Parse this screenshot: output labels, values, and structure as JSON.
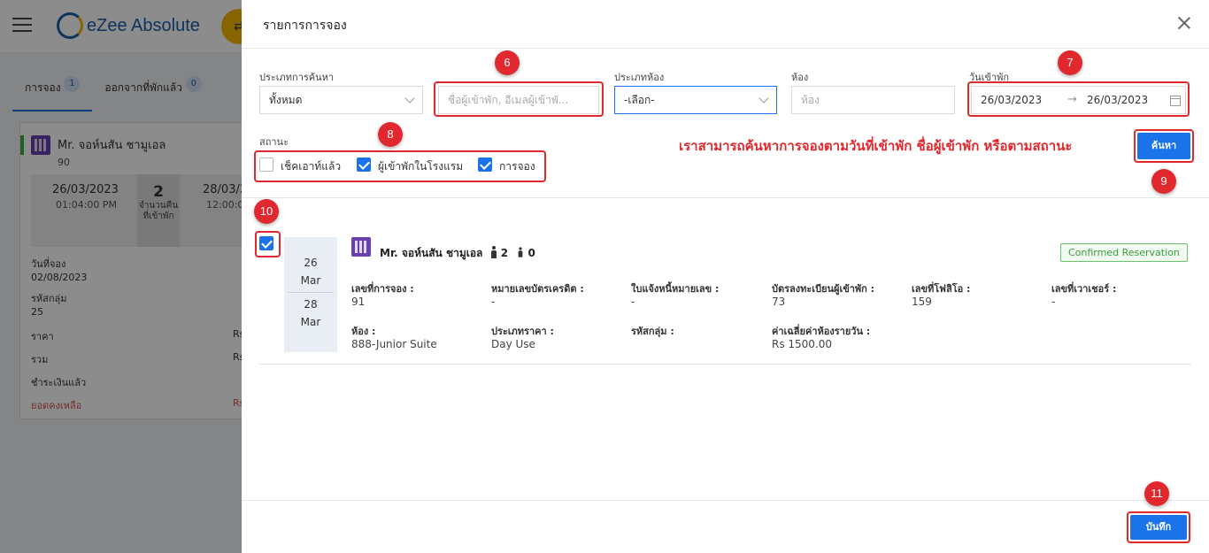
{
  "app": {
    "brand": "eZee Absolute",
    "yellow_icon": "⇄",
    "tabs": [
      {
        "label": "การจอง",
        "badge": "1"
      },
      {
        "label": "ออกจากที่พักแล้ว",
        "badge": "0"
      }
    ],
    "card": {
      "guest_name": "Mr. จอห์นสัน ชามูเอล",
      "guest_no": "90",
      "arrival_date": "26/03/2023",
      "arrival_time": "01:04:00 PM",
      "nights": "2",
      "nights_label": "จำนวนคืนที่เข้าพัก",
      "departure_date": "28/03/2",
      "departure_time": "12:00:0",
      "booking_date_label": "วันที่จอง",
      "booking_date": "02/08/2023",
      "group_code_label": "รหัสกลุ่ม",
      "group_code": "25",
      "rate_label": "ราคา",
      "rate_val": "Rs",
      "total_label": "รวม",
      "total_val": "Rs",
      "paid_label": "ชำระเงินแล้ว",
      "balance_label": "ยอดคงเหลือ",
      "balance_val": "Rs"
    }
  },
  "drawer": {
    "title": "รายการการจอง",
    "search_type_label": "ประเภทการค้นหา",
    "search_type_value": "ทั้งหมด",
    "guest_search_placeholder": "ชื่อผู้เข้าพัก, อีเมลผู้เข้าพั...",
    "room_type_label": "ประเภทห้อง",
    "room_type_value": "-เลือก-",
    "room_label": "ห้อง",
    "room_placeholder": "ห้อง",
    "checkin_label": "วันเข้าพัก",
    "date_from": "26/03/2023",
    "date_to": "26/03/2023",
    "date_arrow": "→",
    "status_label": "สถานะ",
    "status_options": [
      {
        "label": "เช็คเอาท์แล้ว",
        "checked": false
      },
      {
        "label": "ผู้เข้าพักในโรงแรม",
        "checked": true
      },
      {
        "label": "การจอง",
        "checked": true
      }
    ],
    "annotation": "เราสามารถค้นหาการจองตามวันที่เข้าพัก ชื่อผู้เข้าพัก หรือตามสถานะ",
    "search_button": "ค้นหา",
    "save_button": "บันทึก",
    "badges": [
      "6",
      "7",
      "8",
      "9",
      "10",
      "11"
    ]
  },
  "reservation": {
    "arrival_day": "26",
    "arrival_month": "Mar",
    "departure_day": "28",
    "departure_month": "Mar",
    "guest_name": "Mr. จอห์นสัน ชามูเอล",
    "adults": "2",
    "children": "0",
    "status": "Confirmed Reservation",
    "fields": [
      {
        "label": "เลขที่การจอง :",
        "value": "91"
      },
      {
        "label": "หมายเลขบัตรเครดิต :",
        "value": "-"
      },
      {
        "label": "ใบแจ้งหนี้หมายเลข :",
        "value": "-"
      },
      {
        "label": "บัตรลงทะเบียนผู้เข้าพัก :",
        "value": "73"
      },
      {
        "label": "เลขที่โฟลิโอ :",
        "value": "159"
      },
      {
        "label": "เลขที่เวาเชอร์ :",
        "value": "-"
      },
      {
        "label": "ห้อง :",
        "value": "888-Junior Suite"
      },
      {
        "label": "ประเภทราคา :",
        "value": "Day Use"
      },
      {
        "label": "รหัสกลุ่ม :",
        "value": ""
      },
      {
        "label": "ค่าเฉลี่ยค่าห้องรายวัน :",
        "value": "Rs 1500.00"
      }
    ]
  },
  "colors": {
    "accent": "#1a73e8",
    "annotation_red": "#e0282e",
    "confirmed_green": "#3c9c3c"
  }
}
